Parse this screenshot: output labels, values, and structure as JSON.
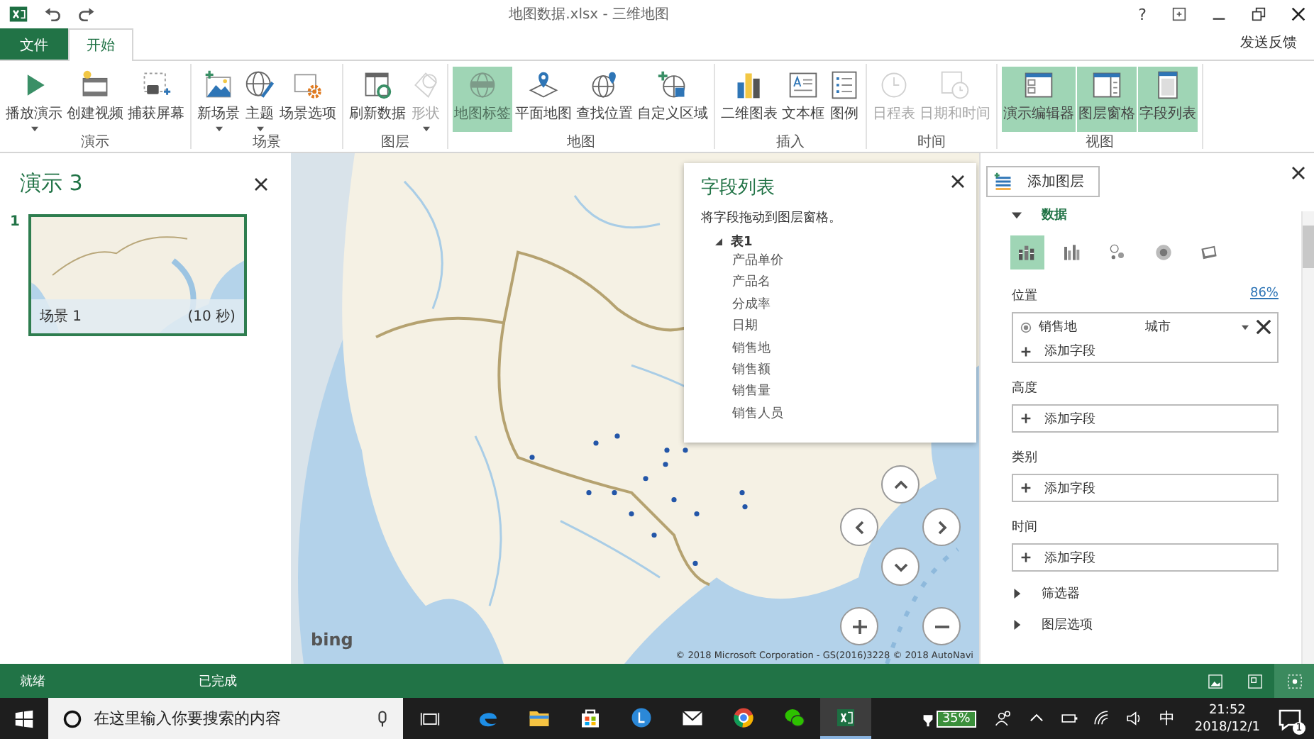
{
  "window": {
    "title": "地图数据.xlsx - 三维地图",
    "help": "?"
  },
  "tabs": [
    {
      "label": "文件",
      "kind": "file",
      "selected": false
    },
    {
      "label": "开始",
      "kind": "tab",
      "selected": true
    }
  ],
  "feedback": "发送反馈",
  "ribbon": {
    "groups": [
      {
        "label": "演示",
        "buttons": [
          {
            "label": "播放演示",
            "kind": "play",
            "dropdown": true,
            "disabled": false,
            "selected": false
          },
          {
            "label": "创建视频",
            "kind": "video",
            "dropdown": false,
            "disabled": false,
            "selected": false
          },
          {
            "label": "捕获屏幕",
            "kind": "camera",
            "dropdown": false,
            "disabled": false,
            "selected": false
          }
        ]
      },
      {
        "label": "场景",
        "buttons": [
          {
            "label": "新场景",
            "kind": "scene",
            "dropdown": true,
            "disabled": false,
            "selected": false
          },
          {
            "label": "主题",
            "kind": "theme",
            "dropdown": true,
            "disabled": false,
            "selected": false
          },
          {
            "label": "场景选项",
            "kind": "options",
            "dropdown": false,
            "disabled": false,
            "selected": false
          }
        ]
      },
      {
        "label": "图层",
        "buttons": [
          {
            "label": "刷新数据",
            "kind": "refresh",
            "dropdown": false,
            "disabled": false,
            "selected": false
          },
          {
            "label": "形状",
            "kind": "shape",
            "dropdown": true,
            "disabled": true,
            "selected": false
          }
        ]
      },
      {
        "label": "地图",
        "buttons": [
          {
            "label": "地图标签",
            "kind": "labels",
            "dropdown": false,
            "disabled": true,
            "selected": true
          },
          {
            "label": "平面地图",
            "kind": "flat",
            "dropdown": false,
            "disabled": false,
            "selected": false
          },
          {
            "label": "查找位置",
            "kind": "find",
            "dropdown": false,
            "disabled": false,
            "selected": false
          },
          {
            "label": "自定义区域",
            "kind": "region",
            "dropdown": false,
            "disabled": false,
            "selected": false
          }
        ]
      },
      {
        "label": "插入",
        "buttons": [
          {
            "label": "二维图表",
            "kind": "chart",
            "dropdown": false,
            "disabled": false,
            "selected": false
          },
          {
            "label": "文本框",
            "kind": "textbox",
            "dropdown": false,
            "disabled": false,
            "selected": false
          },
          {
            "label": "图例",
            "kind": "legend",
            "dropdown": false,
            "disabled": false,
            "selected": false
          }
        ]
      },
      {
        "label": "时间",
        "buttons": [
          {
            "label": "日程表",
            "kind": "timeline",
            "dropdown": false,
            "disabled": true,
            "selected": false
          },
          {
            "label": "日期和时间",
            "kind": "datetime",
            "dropdown": false,
            "disabled": true,
            "selected": false
          }
        ]
      },
      {
        "label": "视图",
        "buttons": [
          {
            "label": "演示编辑器",
            "kind": "tourpane",
            "dropdown": false,
            "disabled": false,
            "selected": true
          },
          {
            "label": "图层窗格",
            "kind": "layerpane",
            "dropdown": false,
            "disabled": false,
            "selected": true
          },
          {
            "label": "字段列表",
            "kind": "fieldpane",
            "dropdown": false,
            "disabled": false,
            "selected": true
          }
        ]
      }
    ]
  },
  "tour": {
    "title": "演示 3",
    "scenes": [
      {
        "number": "1",
        "name": "场景 1",
        "duration": "(10 秒)",
        "selected": true
      }
    ]
  },
  "map": {
    "logo": "bing",
    "copyright": "© 2018 Microsoft Corporation - GS(2016)3228 © 2018 AutoNavi"
  },
  "field_list": {
    "title": "字段列表",
    "hint": "将字段拖动到图层窗格。",
    "tree": [
      {
        "label": "表1",
        "expanded": true,
        "children": [
          {
            "label": "产品单价"
          },
          {
            "label": "产品名"
          },
          {
            "label": "分成率"
          },
          {
            "label": "日期"
          },
          {
            "label": "销售地"
          },
          {
            "label": "销售额"
          },
          {
            "label": "销售量"
          },
          {
            "label": "销售人员"
          }
        ]
      }
    ]
  },
  "layer_pane": {
    "add_layer": "添加图层",
    "section": {
      "label": "数据",
      "expanded": true
    },
    "viz_types": [
      {
        "kind": "stacked",
        "selected": true
      },
      {
        "kind": "clustered",
        "selected": false
      },
      {
        "kind": "bubble",
        "selected": false
      },
      {
        "kind": "heat",
        "selected": false
      },
      {
        "kind": "region",
        "selected": false
      }
    ],
    "location": {
      "label": "位置",
      "confidence": "86%",
      "fields": [
        {
          "name": "销售地",
          "type": "城市"
        }
      ],
      "add": "添加字段"
    },
    "wells": [
      {
        "label": "高度",
        "add": "添加字段"
      },
      {
        "label": "类别",
        "add": "添加字段"
      },
      {
        "label": "时间",
        "add": "添加字段"
      }
    ],
    "sections": [
      {
        "label": "筛选器",
        "expanded": false
      },
      {
        "label": "图层选项",
        "expanded": false
      }
    ]
  },
  "status_bar": {
    "left": "就绪",
    "middle": "已完成",
    "views": [
      {
        "kind": "tour",
        "selected": false
      },
      {
        "kind": "map",
        "selected": false
      },
      {
        "kind": "fit",
        "selected": true
      }
    ]
  },
  "taskbar": {
    "search": {
      "placeholder": "在这里输入你要搜索的内容"
    },
    "apps": [
      {
        "kind": "edge",
        "selected": false
      },
      {
        "kind": "folder",
        "selected": false
      },
      {
        "kind": "store",
        "selected": false
      },
      {
        "kind": "circle",
        "selected": false
      },
      {
        "kind": "mail",
        "selected": false
      },
      {
        "kind": "chrome",
        "selected": false
      },
      {
        "kind": "chat",
        "selected": false
      },
      {
        "kind": "excel",
        "selected": true
      }
    ],
    "battery": "35%",
    "ime": "中",
    "time": "21:52",
    "date": "2018/12/1",
    "notifications": "1"
  }
}
